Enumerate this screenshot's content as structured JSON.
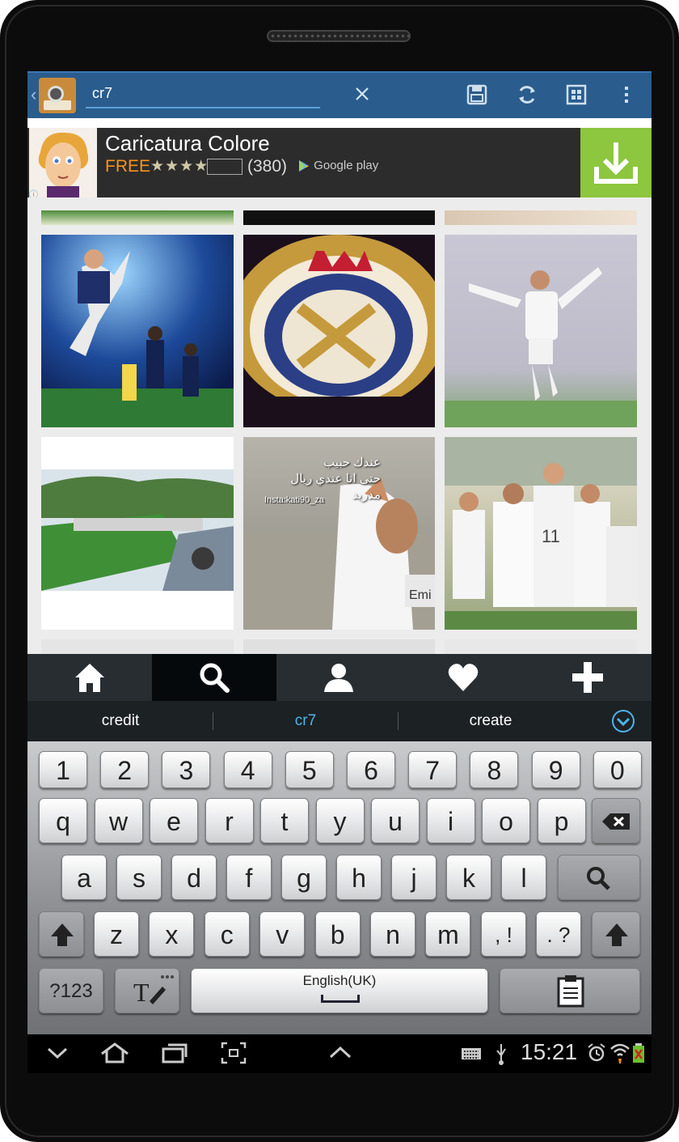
{
  "search": {
    "value": "cr7"
  },
  "ad": {
    "title": "Caricatura Colore",
    "price": "FREE",
    "stars": "★★★★",
    "rating_count": "(380)",
    "store": "Google play",
    "info": "ⓘ",
    "star_rating": 3.5
  },
  "tiles": [
    {
      "overlay_text": ""
    },
    {
      "overlay_text": ""
    },
    {
      "overlay_text": ""
    },
    {
      "overlay_text": ""
    },
    {
      "overlay_text": "عندك حبيب\nحتى انا عندي ريال مدريد"
    },
    {
      "overlay_text": ""
    }
  ],
  "tile_caption": "Insta:kati90_za",
  "suggestions": [
    "credit",
    "cr7",
    "create"
  ],
  "keyboard": {
    "row_numbers": [
      "1",
      "2",
      "3",
      "4",
      "5",
      "6",
      "7",
      "8",
      "9",
      "0"
    ],
    "row_q": [
      "q",
      "w",
      "e",
      "r",
      "t",
      "y",
      "u",
      "i",
      "o",
      "p"
    ],
    "row_a": [
      "a",
      "s",
      "d",
      "f",
      "g",
      "h",
      "j",
      "k",
      "l"
    ],
    "row_z": [
      "z",
      "x",
      "c",
      "v",
      "b",
      "n",
      "m"
    ],
    "comma": ", !",
    "period": ". ?",
    "symbols": "?123",
    "space": "English(UK)"
  },
  "system": {
    "clock": "15:21"
  },
  "colors": {
    "actionbar": "#2a5c8d",
    "ad_download": "#8dc63f",
    "ad_free": "#f7941d",
    "suggestion_active": "#4fb3e8"
  }
}
